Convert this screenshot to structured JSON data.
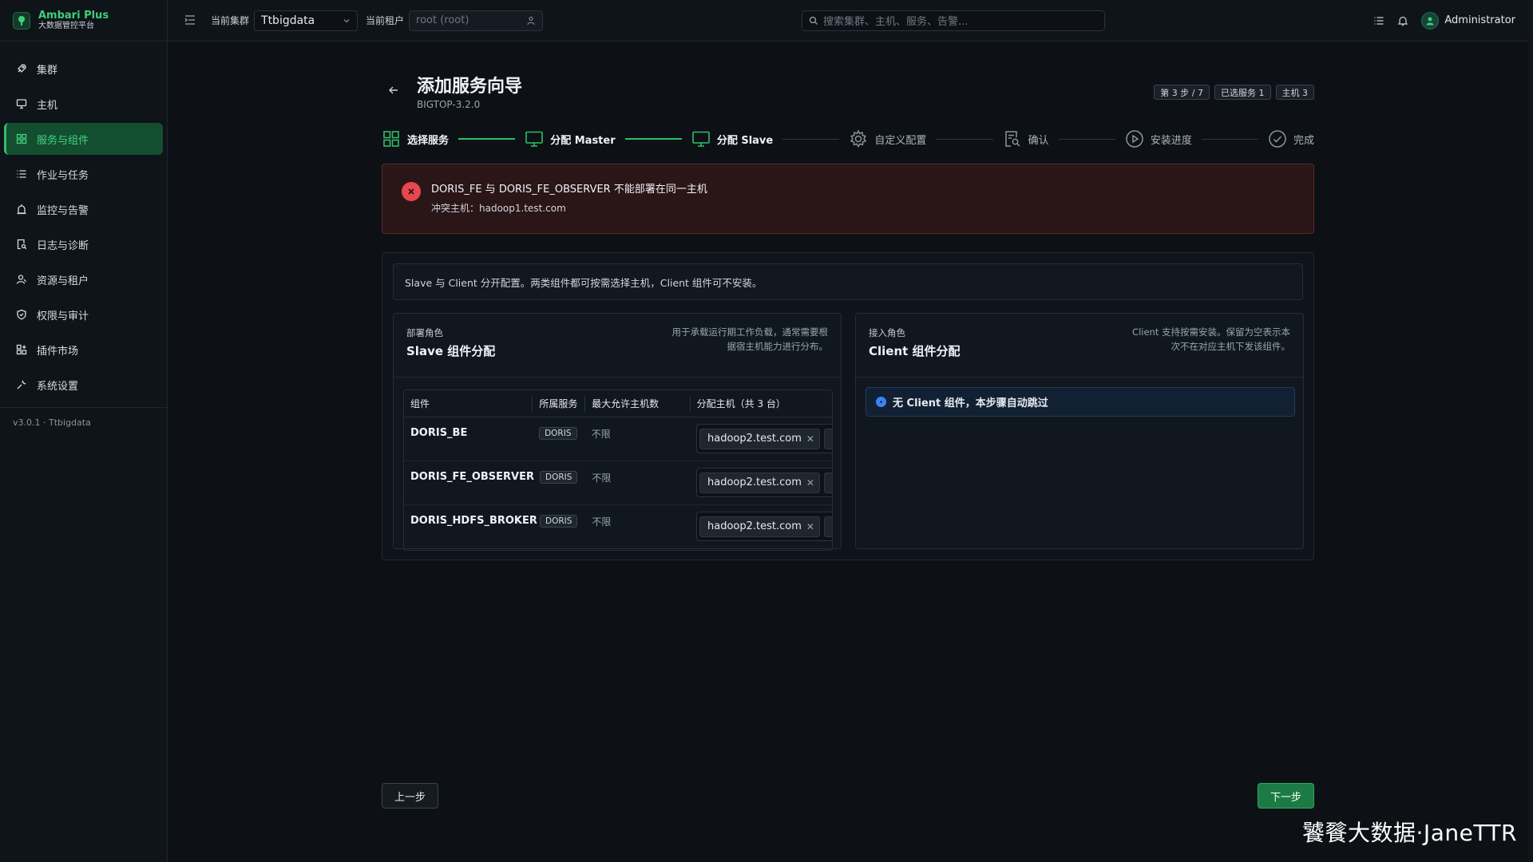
{
  "app": {
    "name": "Ambari Plus",
    "subtitle": "大数据管控平台",
    "version": "v3.0.1 · Ttbigdata"
  },
  "sidebar": {
    "items": [
      {
        "label": "集群",
        "icon": "rocket-icon",
        "active": false
      },
      {
        "label": "主机",
        "icon": "monitor-icon",
        "active": false
      },
      {
        "label": "服务与组件",
        "icon": "grid-icon",
        "active": true
      },
      {
        "label": "作业与任务",
        "icon": "list-icon",
        "active": false
      },
      {
        "label": "监控与告警",
        "icon": "alarm-icon",
        "active": false
      },
      {
        "label": "日志与诊断",
        "icon": "log-search-icon",
        "active": false
      },
      {
        "label": "资源与租户",
        "icon": "users-icon",
        "active": false
      },
      {
        "label": "权限与审计",
        "icon": "shield-icon",
        "active": false
      },
      {
        "label": "插件市场",
        "icon": "apps-icon",
        "active": false
      },
      {
        "label": "系统设置",
        "icon": "wrench-icon",
        "active": false
      }
    ]
  },
  "topbar": {
    "cluster_label": "当前集群",
    "cluster_value": "Ttbigdata",
    "tenant_label": "当前租户",
    "tenant_value": "root (root)",
    "search_placeholder": "搜索集群、主机、服务、告警...",
    "user_name": "Administrator"
  },
  "wizard": {
    "title": "添加服务向导",
    "stack": "BIGTOP-3.2.0",
    "badges": [
      "第 3 步 / 7",
      "已选服务 1",
      "主机 3"
    ],
    "steps": [
      {
        "label": "选择服务",
        "state": "done",
        "icon": "grid-icon"
      },
      {
        "label": "分配 Master",
        "state": "done",
        "icon": "monitor-icon"
      },
      {
        "label": "分配 Slave",
        "state": "current",
        "icon": "monitor-icon"
      },
      {
        "label": "自定义配置",
        "state": "pending",
        "icon": "gear-icon"
      },
      {
        "label": "确认",
        "state": "pending",
        "icon": "document-search-icon"
      },
      {
        "label": "安装进度",
        "state": "pending",
        "icon": "play-circle-icon"
      },
      {
        "label": "完成",
        "state": "pending",
        "icon": "check-circle-icon"
      }
    ]
  },
  "alert": {
    "title": "DORIS_FE 与 DORIS_FE_OBSERVER 不能部署在同一主机",
    "detail": "冲突主机：hadoop1.test.com",
    "color": "#e5484d"
  },
  "info_text": "Slave 与 Client 分开配置。两类组件都可按需选择主机，Client 组件可不安装。",
  "slave_card": {
    "role": "部署角色",
    "title": "Slave 组件分配",
    "desc": "用于承载运行期工作负载，通常需要根据宿主机能力进行分布。",
    "columns": [
      "组件",
      "所属服务",
      "最大允许主机数",
      "分配主机（共 3 台）"
    ],
    "rows": [
      {
        "component": "DORIS_BE",
        "service": "DORIS",
        "max": "不限",
        "host": "hadoop2.test.com",
        "overflow": "ha"
      },
      {
        "component": "DORIS_FE_OBSERVER",
        "service": "DORIS",
        "max": "不限",
        "host": "hadoop2.test.com",
        "overflow": "ha"
      },
      {
        "component": "DORIS_HDFS_BROKER",
        "service": "DORIS",
        "max": "不限",
        "host": "hadoop2.test.com",
        "overflow": "ha"
      }
    ]
  },
  "client_card": {
    "role": "接入角色",
    "title": "Client 组件分配",
    "desc": "Client 支持按需安装。保留为空表示本次不在对应主机下发该组件。",
    "note": "无 Client 组件，本步骤自动跳过"
  },
  "buttons": {
    "prev": "上一步",
    "next": "下一步"
  },
  "watermark": "饕餮大数据·JaneTTR",
  "colors": {
    "accent": "#2fbd68",
    "error": "#e5484d",
    "info": "#3b82f6"
  }
}
